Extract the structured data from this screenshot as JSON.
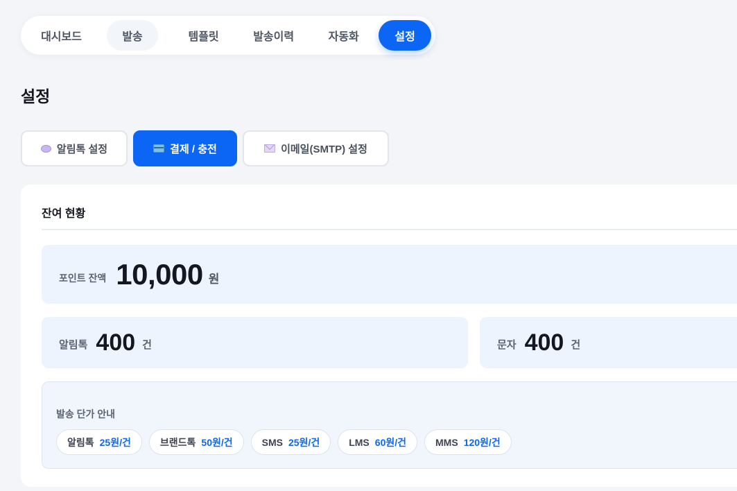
{
  "nav": {
    "items": [
      {
        "label": "대시보드"
      },
      {
        "label": "발송"
      },
      {
        "label": "템플릿"
      },
      {
        "label": "발송이력"
      },
      {
        "label": "자동화"
      },
      {
        "label": "설정"
      }
    ],
    "active": "설정"
  },
  "page": {
    "title": "설정"
  },
  "subtabs": [
    {
      "label": "알림톡 설정",
      "icon": "chat-bubble-icon"
    },
    {
      "label": "결제 / 충전",
      "icon": "credit-card-icon"
    },
    {
      "label": "이메일(SMTP) 설정",
      "icon": "envelope-icon"
    }
  ],
  "balance": {
    "section_title": "잔여 현황",
    "points": {
      "label": "포인트 잔액",
      "value": "10,000",
      "unit": "원"
    },
    "alimtalk": {
      "label": "알림톡",
      "value": "400",
      "unit": "건"
    },
    "sms": {
      "label": "문자",
      "value": "400",
      "unit": "건"
    }
  },
  "pricing": {
    "title": "발송 단가 안내",
    "items": [
      {
        "name": "알림톡",
        "price": "25원/건"
      },
      {
        "name": "브랜드톡",
        "price": "50원/건"
      },
      {
        "name": "SMS",
        "price": "25원/건"
      },
      {
        "name": "LMS",
        "price": "60원/건"
      },
      {
        "name": "MMS",
        "price": "120원/건"
      }
    ]
  },
  "colors": {
    "accent": "#0b65f5",
    "box_bg": "#eef4fd",
    "page_bg": "#f3f5f8"
  }
}
